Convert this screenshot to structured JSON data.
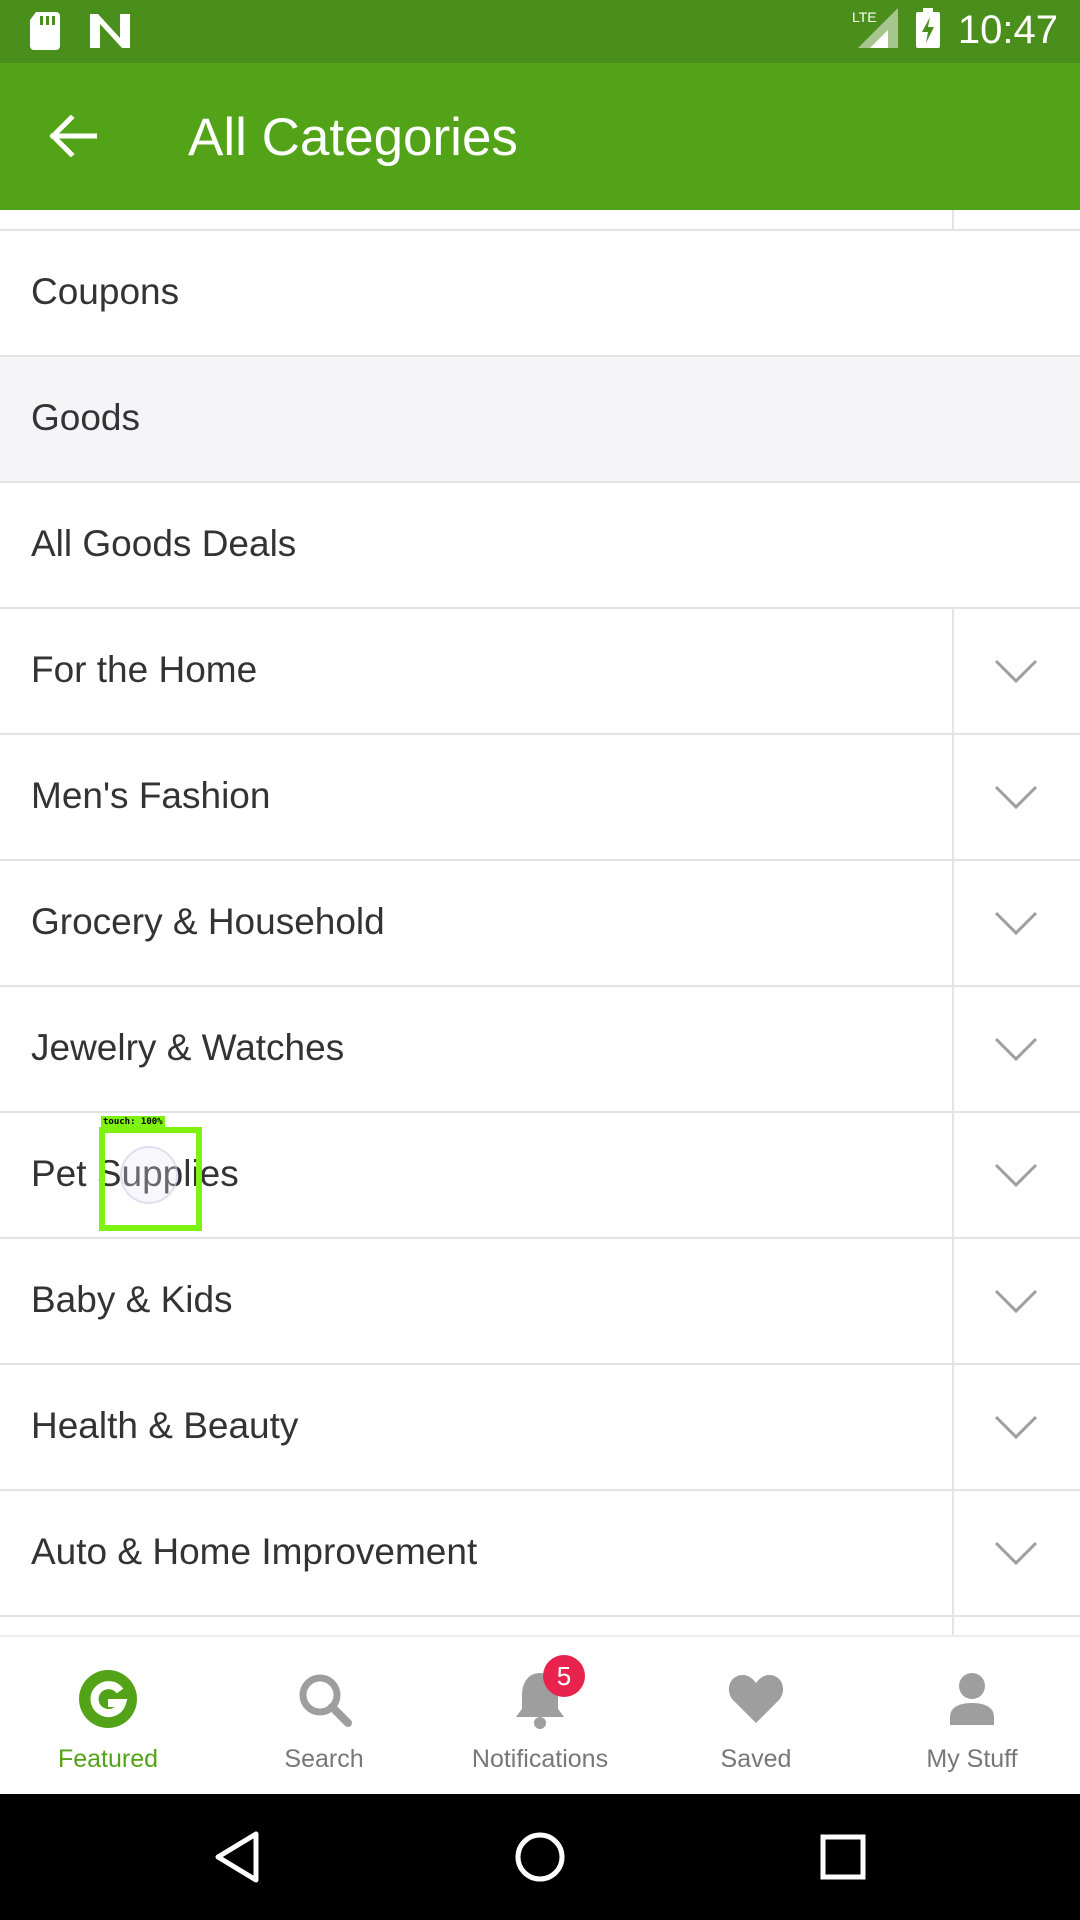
{
  "status_bar": {
    "time": "10:47",
    "network": "LTE",
    "icons": [
      "sd-card-icon",
      "n-notification-icon",
      "lte-signal-icon",
      "battery-charging-icon"
    ]
  },
  "app_bar": {
    "title": "All Categories",
    "back_icon": "arrow-left-icon"
  },
  "list": {
    "rows": [
      {
        "label": "Coupons",
        "expandable": false,
        "header": false
      },
      {
        "label": "Goods",
        "expandable": false,
        "header": true
      },
      {
        "label": "All Goods Deals",
        "expandable": false,
        "header": false
      },
      {
        "label": "For the Home",
        "expandable": true,
        "header": false
      },
      {
        "label": "Men's Fashion",
        "expandable": true,
        "header": false
      },
      {
        "label": "Grocery & Household",
        "expandable": true,
        "header": false
      },
      {
        "label": "Jewelry & Watches",
        "expandable": true,
        "header": false
      },
      {
        "label": "Pet Supplies",
        "expandable": true,
        "header": false
      },
      {
        "label": "Baby & Kids",
        "expandable": true,
        "header": false
      },
      {
        "label": "Health & Beauty",
        "expandable": true,
        "header": false
      },
      {
        "label": "Auto & Home Improvement",
        "expandable": true,
        "header": false
      }
    ]
  },
  "touch_overlay": {
    "label": "touch: 100%"
  },
  "bottom_nav": {
    "items": [
      {
        "label": "Featured",
        "icon": "groupon-g-icon",
        "active": true
      },
      {
        "label": "Search",
        "icon": "search-icon",
        "active": false
      },
      {
        "label": "Notifications",
        "icon": "bell-icon",
        "active": false
      },
      {
        "label": "Saved",
        "icon": "heart-icon",
        "active": false
      },
      {
        "label": "My Stuff",
        "icon": "person-icon",
        "active": false
      }
    ],
    "notification_badge": "5"
  },
  "colors": {
    "status_bar": "#4a8f1c",
    "app_bar": "#53a318",
    "accent": "#53a318",
    "badge": "#e8234d",
    "divider": "#e3e3e3"
  }
}
